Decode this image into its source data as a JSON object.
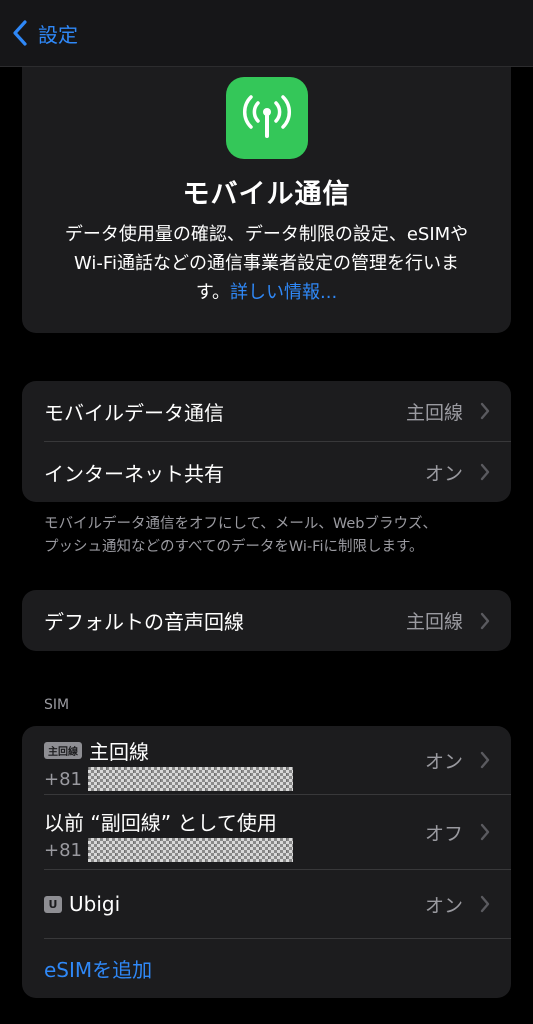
{
  "nav": {
    "back_label": "設定"
  },
  "hero": {
    "icon": "antenna-radiowaves-icon",
    "icon_color": "#34c759",
    "title": "モバイル通信",
    "desc_line1": "データ使用量の確認、データ制限の設定、eSIMや",
    "desc_line2": "Wi-Fi通話などの通信事業者設定の管理を行いま",
    "desc_line3": "す。",
    "link": "詳しい情報..."
  },
  "data_group": {
    "mobile_data": {
      "label": "モバイルデータ通信",
      "value": "主回線"
    },
    "hotspot": {
      "label": "インターネット共有",
      "value": "オン"
    }
  },
  "footnote": {
    "line1": "モバイルデータ通信をオフにして、メール、Webブラウズ、",
    "line2": "プッシュ通知などのすべてのデータをWi-Fiに制限します。"
  },
  "voice": {
    "label": "デフォルトの音声回線",
    "value": "主回線"
  },
  "sim_section": {
    "header": "SIM",
    "items": [
      {
        "badge": "主回線",
        "name": "主回線",
        "number_prefix": "+81",
        "status": "オン"
      },
      {
        "name": "以前 “副回線” として使用",
        "number_prefix": "+81",
        "status": "オフ"
      },
      {
        "badge": "U",
        "name": "Ubigi",
        "status": "オン"
      }
    ],
    "add_esim": "eSIMを追加"
  },
  "colors": {
    "accent": "#2f88f7",
    "green": "#34c759",
    "card": "#1c1c1e",
    "bg": "#000000"
  }
}
